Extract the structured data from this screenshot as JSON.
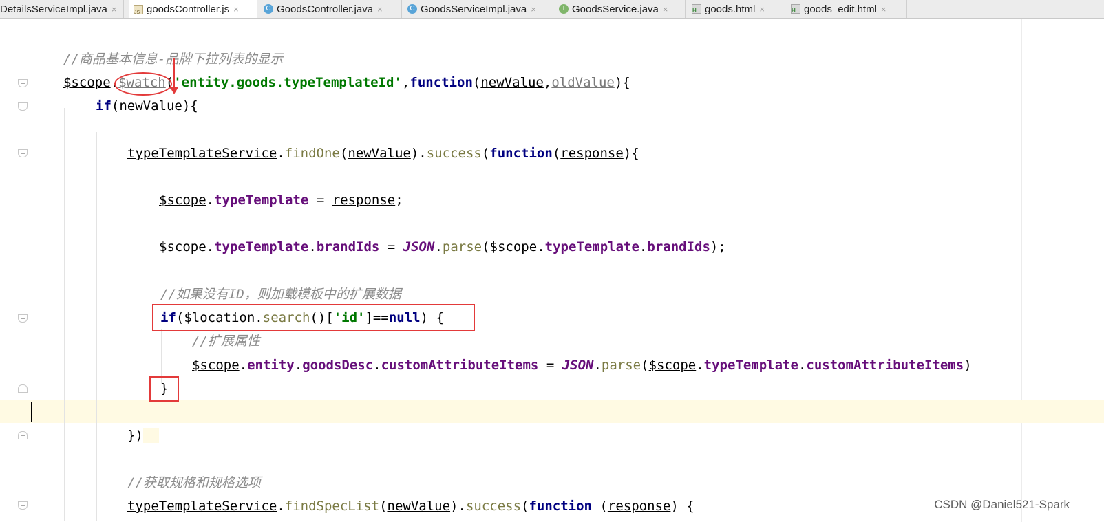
{
  "tabs": [
    {
      "label": "DetailsServiceImpl.java",
      "icon": "none",
      "active": false
    },
    {
      "label": "goodsController.js",
      "icon": "js-file-icon",
      "active": true
    },
    {
      "label": "GoodsController.java",
      "icon": "java-class-icon",
      "active": false
    },
    {
      "label": "GoodsServiceImpl.java",
      "icon": "java-class-icon",
      "active": false
    },
    {
      "label": "GoodsService.java",
      "icon": "java-interface-icon",
      "active": false
    },
    {
      "label": "goods.html",
      "icon": "html-file-icon",
      "active": false
    },
    {
      "label": "goods_edit.html",
      "icon": "html-file-icon",
      "active": false
    }
  ],
  "tab_close_glyph": "×",
  "class_icon_letter": "C",
  "interface_icon_letter": "I",
  "code": {
    "line1": "//商品基本信息-品牌下拉列表的显示",
    "line2": {
      "scope": "$scope",
      "dot": ".",
      "watch": "$watch",
      "open": "(",
      "str": "'entity.goods.typeTemplateId'",
      "comma": ",",
      "function": "function",
      "p1": "newValue",
      "sep": ",",
      "p2": "oldValue",
      "close": "){"
    },
    "line3": {
      "if": "if",
      "open": "(",
      "arg": "newValue",
      "close": "){"
    },
    "line4": {
      "svc": "typeTemplateService",
      "dot": ".",
      "m1": "findOne",
      "o": "(",
      "arg": "newValue",
      "c": ")",
      "dot2": ".",
      "m2": "success",
      "o2": "(",
      "function": "function",
      "o3": "(",
      "resp": "response",
      "c3": "){"
    },
    "line5": {
      "scope": "$scope",
      "dot": ".",
      "prop": "typeTemplate",
      "eq": " = ",
      "resp": "response",
      "semi": ";"
    },
    "line6": {
      "scope": "$scope",
      "dot": ".",
      "prop1": "typeTemplate",
      "dot2": ".",
      "prop2": "brandIds",
      "eq": " = ",
      "json": "JSON",
      "dot3": ".",
      "parse": "parse",
      "o": "(",
      "scope2": "$scope",
      "dot4": ".",
      "prop3": "typeTemplate",
      "dot5": ".",
      "prop4": "brandIds",
      "c": ");"
    },
    "line7": "//如果没有ID，则加载模板中的扩展数据",
    "line8": {
      "if": "if",
      "o": "(",
      "loc": "$location",
      "dot": ".",
      "m": "search",
      "call": "()[",
      "str": "'id'",
      "eqeq": "]==",
      "null": "null",
      "c": ") {"
    },
    "line9": "//扩展属性",
    "line10": {
      "scope": "$scope",
      "dot": ".",
      "p1": "entity",
      "dot2": ".",
      "p2": "goodsDesc",
      "dot3": ".",
      "p3": "customAttributeItems",
      "eq": " = ",
      "json": "JSON",
      "dot4": ".",
      "parse": "parse",
      "o": "(",
      "scope2": "$scope",
      "dot5": ".",
      "p4": "typeTemplate",
      "dot6": ".",
      "p5": "customAttributeItems",
      "c": ")"
    },
    "line11": "}",
    "line12": "})",
    "line13": "//获取规格和规格选项",
    "line14": {
      "svc": "typeTemplateService",
      "dot": ".",
      "m1": "findSpecList",
      "o": "(",
      "arg": "newValue",
      "c": ")",
      "dot2": ".",
      "m2": "success",
      "o2": "(",
      "function": "function",
      "sp": " (",
      "resp": "response",
      "c2": ") {"
    }
  },
  "watermark": "CSDN @Daniel521-Spark",
  "colors": {
    "annotation": "#e33a3a",
    "current_line": "#fffae3",
    "keyword": "#000080",
    "string": "#007800",
    "property": "#660e7a",
    "method": "#7a7a43",
    "comment": "#8c8c8c"
  }
}
